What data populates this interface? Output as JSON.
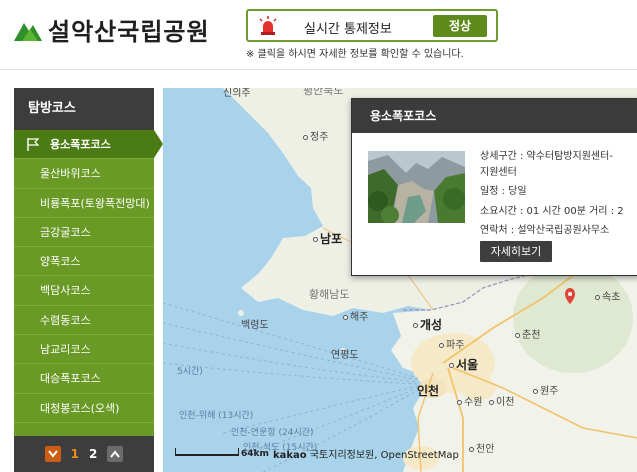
{
  "header": {
    "logo_text": "설악산국립공원",
    "status_label": "실시간 통제정보",
    "status_badge": "정상",
    "notice": "※ 클릭을 하시면 자세한 정보를 확인할 수 있습니다."
  },
  "sidebar": {
    "title": "탐방코스",
    "items": [
      {
        "label": "용소폭포코스",
        "active": true
      },
      {
        "label": "울산바위코스"
      },
      {
        "label": "비룡폭포(토왕폭전망대)"
      },
      {
        "label": "금강굴코스"
      },
      {
        "label": "양폭코스"
      },
      {
        "label": "백담사코스"
      },
      {
        "label": "수렴동코스"
      },
      {
        "label": "남교리코스"
      },
      {
        "label": "대승폭포코스"
      },
      {
        "label": "대청봉코스(오색)"
      }
    ],
    "pager": {
      "pages": [
        "1",
        "2"
      ],
      "current": "1"
    }
  },
  "map": {
    "labels": {
      "top_city": "신의주",
      "top_region": "평안북도",
      "jeongju": "정주",
      "nampo": "남포",
      "hwanghae": "황해남도",
      "baengnyeong": "백령도",
      "haeju": "해주",
      "kaesong": "개성",
      "paju": "파주",
      "yeonpyeong": "연평도",
      "seoul": "서울",
      "incheon": "인천",
      "suwon": "수원",
      "icheon": "이천",
      "wonju": "원주",
      "chuncheon": "춘천",
      "sokcho": "속초",
      "cheonan": "천안",
      "route_1": "인천-위해 (13시간)",
      "route_2": "인천-연운항 (24시간)",
      "route_3": "인천-석도 (15시간)",
      "route_4": "5시간)"
    },
    "scale": "64km",
    "attribution_brand": "kakao",
    "attribution_rest": "국토지리정보원, OpenStreetMap"
  },
  "popup": {
    "title": "용소폭포코스",
    "detail_section": "상세구간 : 약수터탐방지원센터-",
    "detail_section_cont": "지원센터",
    "schedule": "일정 : 당일",
    "duration": "소요시간 : 01 시간 00분   거리 : 2",
    "contact": "연락처 : 설악산국립공원사무소",
    "button": "자세히보기"
  },
  "colors": {
    "brand_green": "#6a9a26",
    "active_green": "#4b7c13",
    "dark_bar": "#3d3d3d",
    "pager_orange": "#cc5d14"
  }
}
